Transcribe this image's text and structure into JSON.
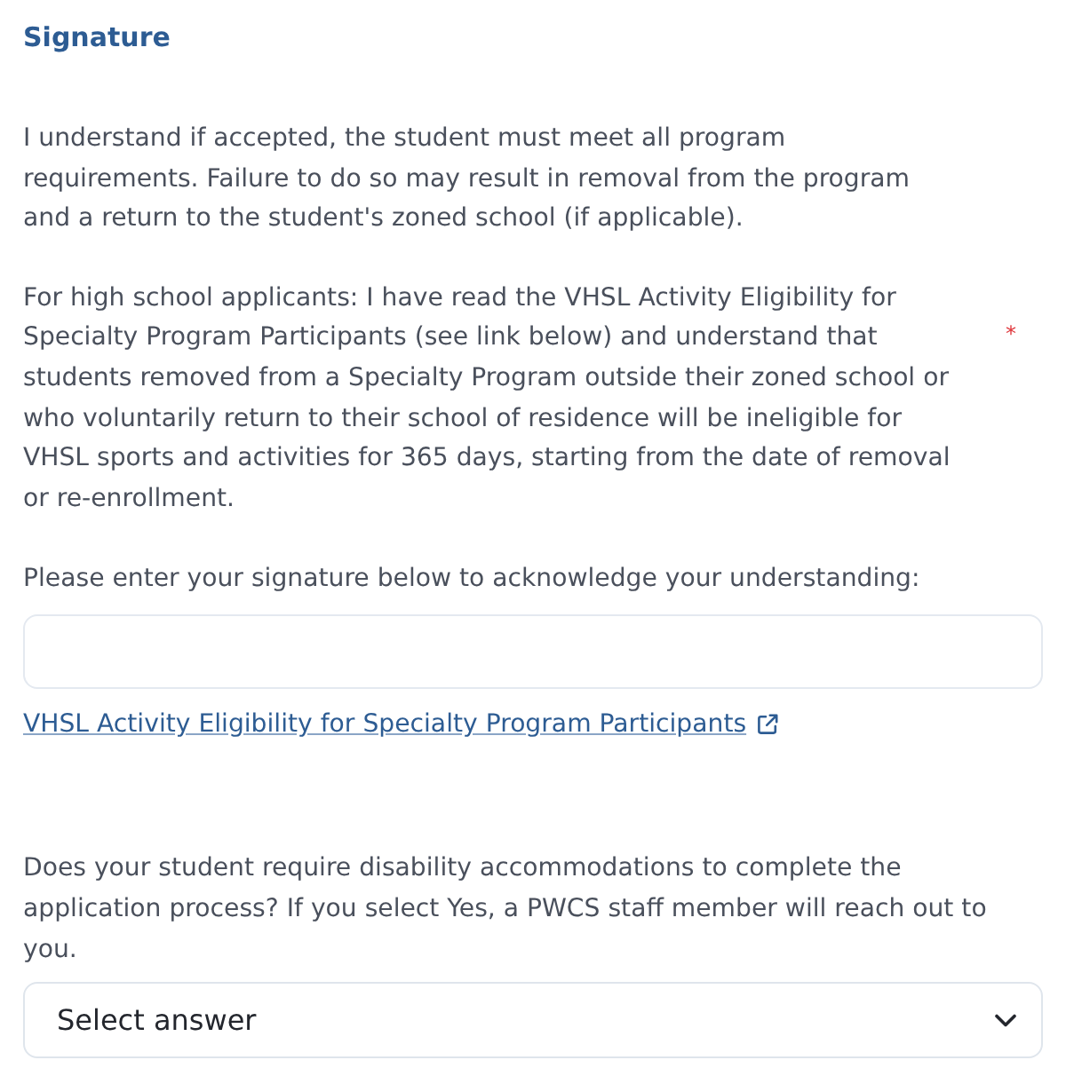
{
  "section": {
    "title": "Signature"
  },
  "agreement": {
    "paragraphs": [
      "I understand if accepted, the student must meet all program requirements. Failure to do so may result in removal from the program and a return to the student's zoned school (if applicable).",
      "For high school applicants: I have read the VHSL Activity Eligibility for Specialty Program Participants (see link below) and understand that students removed from a Specialty Program outside their zoned school or who voluntarily return to their school of residence will be ineligible for VHSL sports and activities for 365 days, starting from the date of removal or re-enrollment."
    ],
    "required_mark": "*"
  },
  "signature": {
    "label": "Please enter your signature below to acknowledge your understanding:"
  },
  "link": {
    "label": "VHSL Activity Eligibility for Specialty Program Participants"
  },
  "accommodations": {
    "question": "Does your student require disability accommodations to complete the application process? If you select Yes, a PWCS staff member will reach out to you.",
    "select": {
      "placeholder": "Select answer"
    }
  }
}
